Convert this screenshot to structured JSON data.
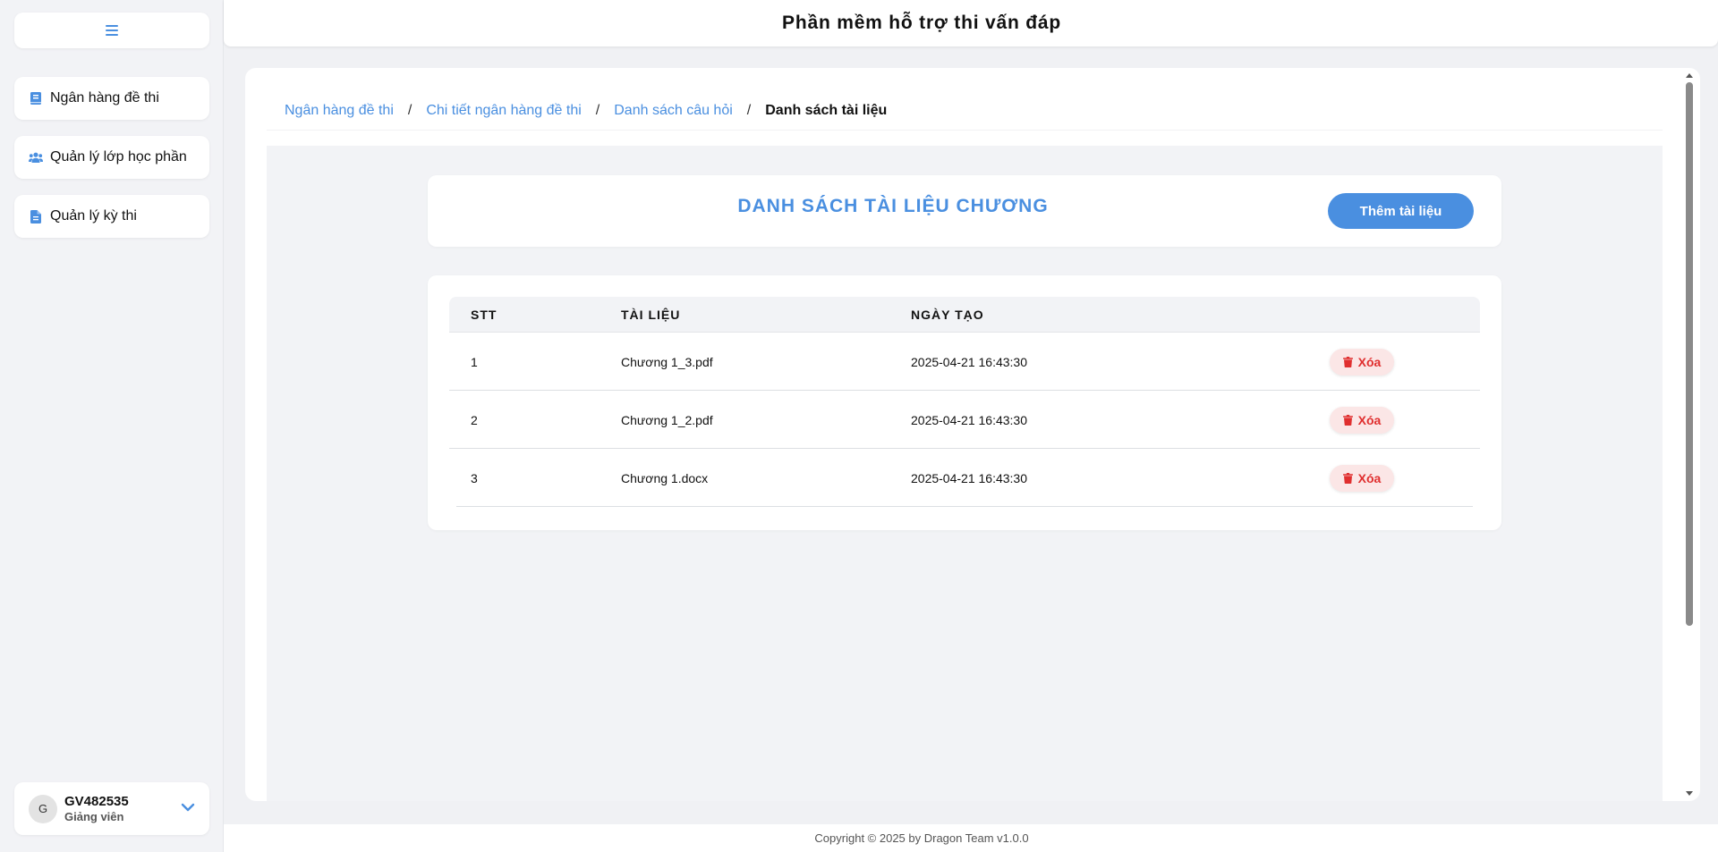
{
  "app": {
    "title": "Phần mềm hỗ trợ thi vấn đáp"
  },
  "sidebar": {
    "items": [
      {
        "label": "Ngân hàng đề thi",
        "icon": "book-icon"
      },
      {
        "label": "Quản lý lớp học phần",
        "icon": "users-icon"
      },
      {
        "label": "Quản lý kỳ thi",
        "icon": "file-icon"
      }
    ],
    "user": {
      "avatar_letter": "G",
      "name": "GV482535",
      "role": "Giảng viên"
    }
  },
  "breadcrumb": {
    "items": [
      "Ngân hàng đề thi",
      "Chi tiết ngân hàng đề thi",
      "Danh sách câu hỏi"
    ],
    "separator": "/",
    "current": "Danh sách tài liệu"
  },
  "main": {
    "list_title": "DANH SÁCH TÀI LIỆU CHƯƠNG",
    "add_button": "Thêm tài liệu",
    "table": {
      "headers": [
        "STT",
        "TÀI LIỆU",
        "NGÀY TẠO"
      ],
      "rows": [
        {
          "stt": "1",
          "document": "Chương 1_3.pdf",
          "created": "2025-04-21 16:43:30",
          "action": "Xóa"
        },
        {
          "stt": "2",
          "document": "Chương 1_2.pdf",
          "created": "2025-04-21 16:43:30",
          "action": "Xóa"
        },
        {
          "stt": "3",
          "document": "Chương 1.docx",
          "created": "2025-04-21 16:43:30",
          "action": "Xóa"
        }
      ]
    }
  },
  "footer": {
    "text": "Copyright © 2025 by Dragon Team v1.0.0"
  },
  "colors": {
    "accent": "#4a8fe0",
    "danger": "#e02f2f",
    "danger_bg": "#fbe6e6",
    "background": "#f2f3f6"
  }
}
